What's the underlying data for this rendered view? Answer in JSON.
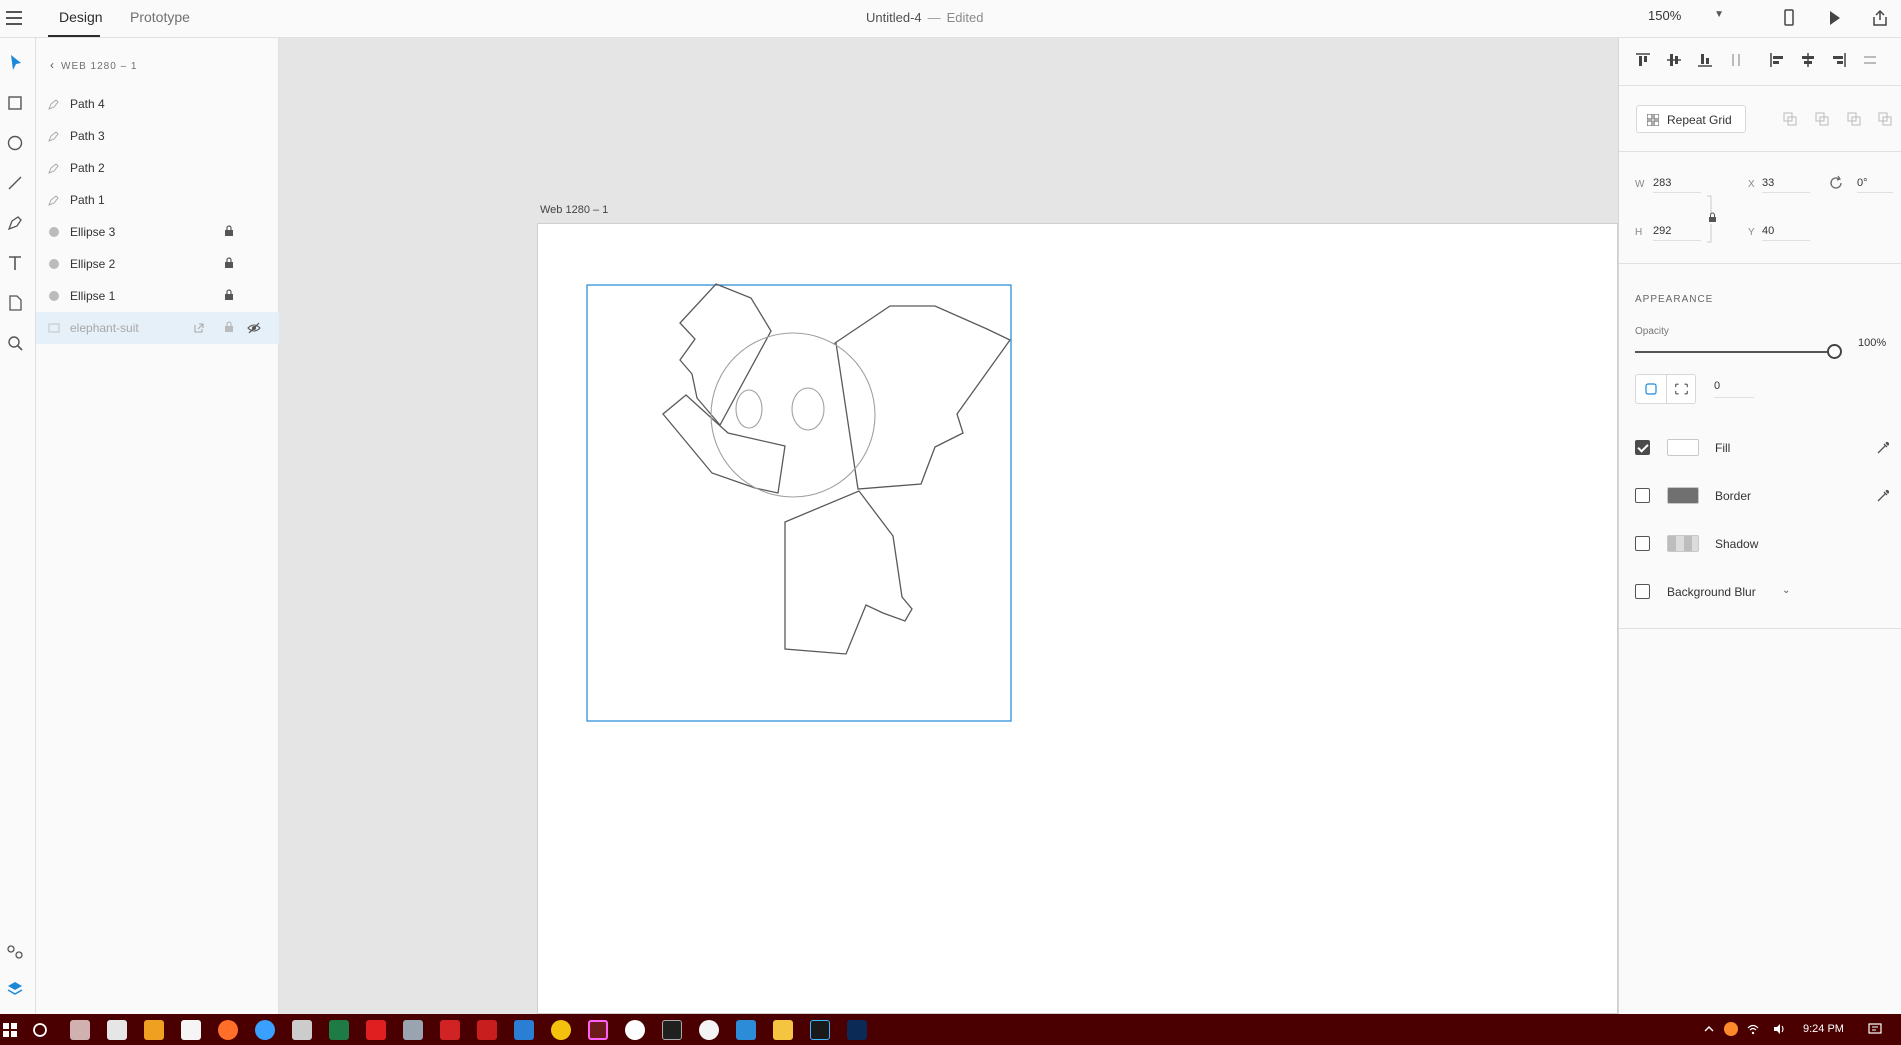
{
  "topbar": {
    "tabs": [
      {
        "label": "Design"
      },
      {
        "label": "Prototype"
      }
    ],
    "doc_name": "Untitled-4",
    "separator": "—",
    "doc_status": "Edited",
    "zoom": "150%"
  },
  "layers": {
    "breadcrumb": "WEB 1280 – 1",
    "items": [
      {
        "name": "Path 4",
        "type": "path",
        "locked": false
      },
      {
        "name": "Path 3",
        "type": "path",
        "locked": false
      },
      {
        "name": "Path 2",
        "type": "path",
        "locked": false
      },
      {
        "name": "Path 1",
        "type": "path",
        "locked": false
      },
      {
        "name": "Ellipse 3",
        "type": "ellipse",
        "locked": true
      },
      {
        "name": "Ellipse 2",
        "type": "ellipse",
        "locked": true
      },
      {
        "name": "Ellipse 1",
        "type": "ellipse",
        "locked": true
      },
      {
        "name": "elephant-suit",
        "type": "image",
        "locked": true,
        "hidden": true,
        "selected": true
      }
    ]
  },
  "canvas": {
    "artboard_label": "Web 1280 – 1",
    "selection_color": "#1e88d8"
  },
  "properties": {
    "repeat_grid_label": "Repeat Grid",
    "w_label": "W",
    "w": "283",
    "h_label": "H",
    "h": "292",
    "x_label": "X",
    "x": "33",
    "y_label": "Y",
    "y": "40",
    "rotation": "0°",
    "appearance_title": "APPEARANCE",
    "opacity_label": "Opacity",
    "opacity_value": "100%",
    "opacity_fraction": 1.0,
    "corner_radius": "0",
    "fill_label": "Fill",
    "fill_checked": true,
    "fill_color": "#ffffff",
    "border_label": "Border",
    "border_checked": false,
    "border_color": "#707070",
    "shadow_label": "Shadow",
    "shadow_checked": false,
    "blur_label": "Background Blur",
    "blur_checked": false
  },
  "taskbar": {
    "time": "9:24 PM",
    "background": "#4a0000",
    "apps": [
      "windows-start",
      "cortana",
      "lambda",
      "calculator",
      "app-orange",
      "calendar",
      "paint",
      "maps",
      "media",
      "excel",
      "acrobat",
      "tool",
      "red-app",
      "filezilla",
      "vscode",
      "chrome",
      "adobe-xd",
      "clock-app",
      "cmd",
      "alarm",
      "notes",
      "explorer",
      "webstorm",
      "terminal"
    ]
  }
}
